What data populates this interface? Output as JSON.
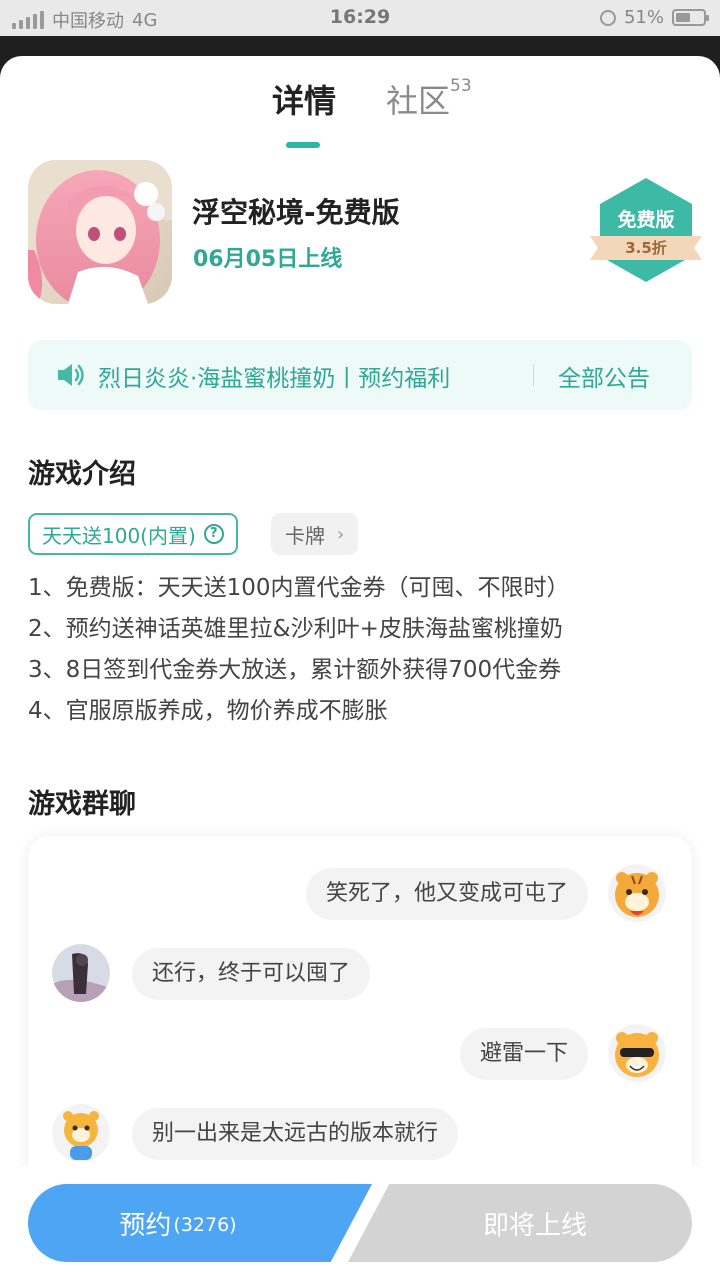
{
  "status_bar": {
    "carrier": "中国移动",
    "network": "4G",
    "time": "16:29",
    "battery": "51%"
  },
  "tabs": [
    {
      "label": "详情",
      "active": true
    },
    {
      "label": "社区",
      "count": "53",
      "active": false
    }
  ],
  "game": {
    "title": "浮空秘境-免费版",
    "release": "06月05日上线",
    "badge_title": "免费版",
    "badge_discount": "3.5折"
  },
  "notice": {
    "text": "烈日炎炎·海盐蜜桃撞奶丨预约福利",
    "all_label": "全部公告"
  },
  "intro": {
    "heading": "游戏介绍",
    "tag_primary": "天天送100(内置)",
    "tag_secondary": "卡牌",
    "lines": [
      "1、免费版：天天送100内置代金券（可囤、不限时）",
      "2、预约送神话英雄里拉&沙利叶+皮肤海盐蜜桃撞奶",
      "3、8日签到代金券大放送，累计额外获得700代金券",
      "4、官服原版养成，物价养成不膨胀"
    ]
  },
  "group_chat": {
    "heading": "游戏群聊",
    "messages": [
      {
        "text": "笑死了，他又变成可屯了",
        "side": "right"
      },
      {
        "text": "还行，终于可以囤了",
        "side": "left"
      },
      {
        "text": "避雷一下",
        "side": "right"
      },
      {
        "text": "别一出来是太远古的版本就行",
        "side": "left"
      }
    ]
  },
  "actions": {
    "reserve_label": "预约",
    "reserve_count": "(3276)",
    "coming_label": "即将上线"
  },
  "colors": {
    "accent": "#2cb6a3",
    "reserve_button": "#4da5f3",
    "disabled_button": "#d3d3d3"
  }
}
